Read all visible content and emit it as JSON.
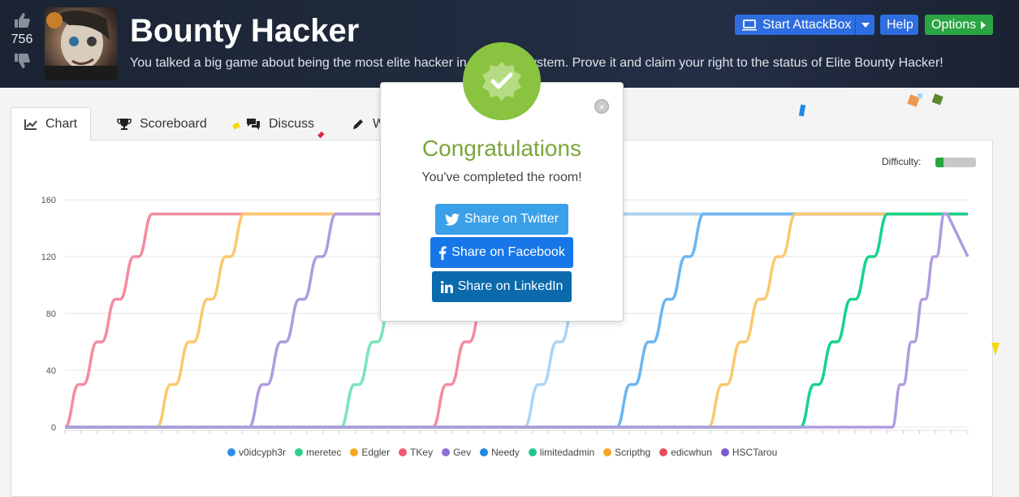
{
  "room": {
    "title": "Bounty Hacker",
    "subtitle": "You talked a big game about being the most elite hacker in the solar system. Prove it and claim your right to the status of Elite Bounty Hacker!",
    "votes": "756"
  },
  "header_buttons": {
    "attackbox": "Start AttackBox",
    "help": "Help",
    "options": "Options"
  },
  "tabs": [
    {
      "label": "Chart",
      "icon": "chart-icon"
    },
    {
      "label": "Scoreboard",
      "icon": "trophy-icon"
    },
    {
      "label": "Discuss",
      "icon": "comments-icon"
    },
    {
      "label": "W",
      "icon": "pencil-icon"
    }
  ],
  "difficulty": {
    "label": "Difficulty:",
    "level": 0.2,
    "color": "#2aa544"
  },
  "modal": {
    "title": "Congratulations",
    "text": "You've completed the room!",
    "twitter": "Share on Twitter",
    "facebook": "Share on Facebook",
    "linkedin": "Share on LinkedIn",
    "close": "×"
  },
  "chart_data": {
    "type": "line",
    "ylim": [
      0,
      160
    ],
    "yticks": [
      "0",
      "40",
      "80",
      "120",
      "160"
    ],
    "max_points": 150,
    "series": [
      {
        "name": "v0idcyph3r",
        "color": "#2f8fe8"
      },
      {
        "name": "meretec",
        "color": "#2ad28e"
      },
      {
        "name": "Edgler",
        "color": "#f5a623"
      },
      {
        "name": "TKey",
        "color": "#f05a6e"
      },
      {
        "name": "Gev",
        "color": "#8e6fd6"
      },
      {
        "name": "Needy",
        "color": "#1e88e5"
      },
      {
        "name": "limitedadmin",
        "color": "#1ec98b"
      },
      {
        "name": "Scripthg",
        "color": "#f5a623"
      },
      {
        "name": "edicwhun",
        "color": "#e84c5d"
      },
      {
        "name": "HSCTarou",
        "color": "#7b5cd0"
      }
    ],
    "lines": [
      {
        "color": "#f48ca0",
        "start": 0.0,
        "end": 1.0
      },
      {
        "color": "#fac86e",
        "start": 1.0,
        "end": 2.0
      },
      {
        "color": "#b19be0",
        "start": 2.0,
        "end": 3.0
      },
      {
        "color": "#7ae4b8",
        "start": 3.0,
        "end": 4.0
      },
      {
        "color": "#f48ca0",
        "start": 4.0,
        "end": 5.0
      },
      {
        "color": "#a9d5f8",
        "start": 5.0,
        "end": 6.0
      },
      {
        "color": "#6ab6f2",
        "start": 6.0,
        "end": 7.0
      },
      {
        "color": "#fac86e",
        "start": 7.0,
        "end": 8.0
      },
      {
        "color": "#17d48a",
        "start": 8.0,
        "end": 9.0
      },
      {
        "color": "#b19be0",
        "start": 9.0,
        "end": 9.6
      }
    ]
  }
}
